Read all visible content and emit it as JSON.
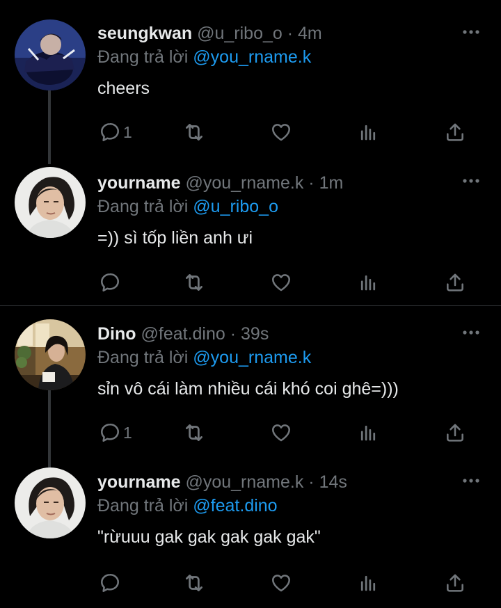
{
  "colors": {
    "background": "#000000",
    "text": "#e7e9ea",
    "muted": "#71767b",
    "mention": "#1d9bf0",
    "divider": "#2f3336"
  },
  "tweets": [
    {
      "name": "seungkwan",
      "handle": "@u_ribo_o",
      "separator": "·",
      "time": "4m",
      "reply_prefix": "Đang trả lời",
      "reply_to": "@you_rname.k",
      "text": "cheers",
      "reply_count": "1",
      "more_icon": "more-dots-icon"
    },
    {
      "name": "yourname",
      "handle": "@you_rname.k",
      "separator": "·",
      "time": "1m",
      "reply_prefix": "Đang trả lời",
      "reply_to": "@u_ribo_o",
      "text": "=)) sì tốp liền anh ưi",
      "reply_count": "",
      "more_icon": "more-dots-icon"
    },
    {
      "name": "Dino",
      "handle": "@feat.dino",
      "separator": "·",
      "time": "39s",
      "reply_prefix": "Đang trả lời",
      "reply_to": "@you_rname.k",
      "text": "sỉn vô cái làm nhiều cái khó coi ghê=)))",
      "reply_count": "1",
      "more_icon": "more-dots-icon"
    },
    {
      "name": "yourname",
      "handle": "@you_rname.k",
      "separator": "·",
      "time": "14s",
      "reply_prefix": "Đang trả lời",
      "reply_to": "@feat.dino",
      "text": "\"rừuuu gak gak gak gak gak\"",
      "reply_count": "",
      "more_icon": "more-dots-icon"
    }
  ],
  "action_icons": [
    "reply-icon",
    "retweet-icon",
    "like-icon",
    "views-icon",
    "share-icon"
  ]
}
